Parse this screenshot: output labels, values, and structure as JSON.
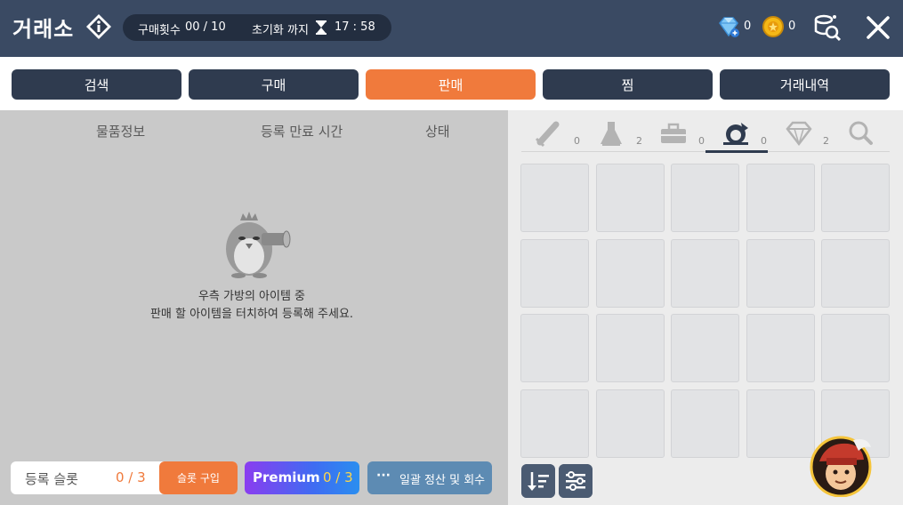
{
  "header": {
    "title": "거래소",
    "purchase_label": "구매횟수",
    "purchase_value": "00 / 10",
    "reset_label": "초기화 까지",
    "reset_time": "17 : 58",
    "gem_count": "0",
    "coin_count": "0"
  },
  "tabs": [
    {
      "label": "검색"
    },
    {
      "label": "구매"
    },
    {
      "label": "판매",
      "active": true
    },
    {
      "label": "찜"
    },
    {
      "label": "거래내역"
    }
  ],
  "left": {
    "columns": [
      "물품정보",
      "등록 만료 시간",
      "상태"
    ],
    "empty_line1": "우측 가방의 아이템 중",
    "empty_line2": "판매 할 아이템을 터치하여 등록해 주세요.",
    "slot_label": "등록 슬롯",
    "slot_count": "0 / 3",
    "slot_buy_label": "슬롯 구입",
    "premium_label": "Premium",
    "premium_count": "0 / 3",
    "settle_dots": "···",
    "settle_label": "일괄 정산 및 회수"
  },
  "inventory": {
    "categories": [
      {
        "icon": "sword-icon",
        "count": "0"
      },
      {
        "icon": "potion-icon",
        "count": "2"
      },
      {
        "icon": "toolbox-icon",
        "count": "0"
      },
      {
        "icon": "costume-icon",
        "count": "0",
        "active": true
      },
      {
        "icon": "diamond-icon",
        "count": "2"
      },
      {
        "icon": "search-icon",
        "count": ""
      }
    ],
    "slots": 20
  },
  "colors": {
    "header_bg": "#3a4a63",
    "tab_bg": "#2f3b4f",
    "accent_orange": "#f07a3c",
    "settle_blue": "#5d8bb3"
  }
}
